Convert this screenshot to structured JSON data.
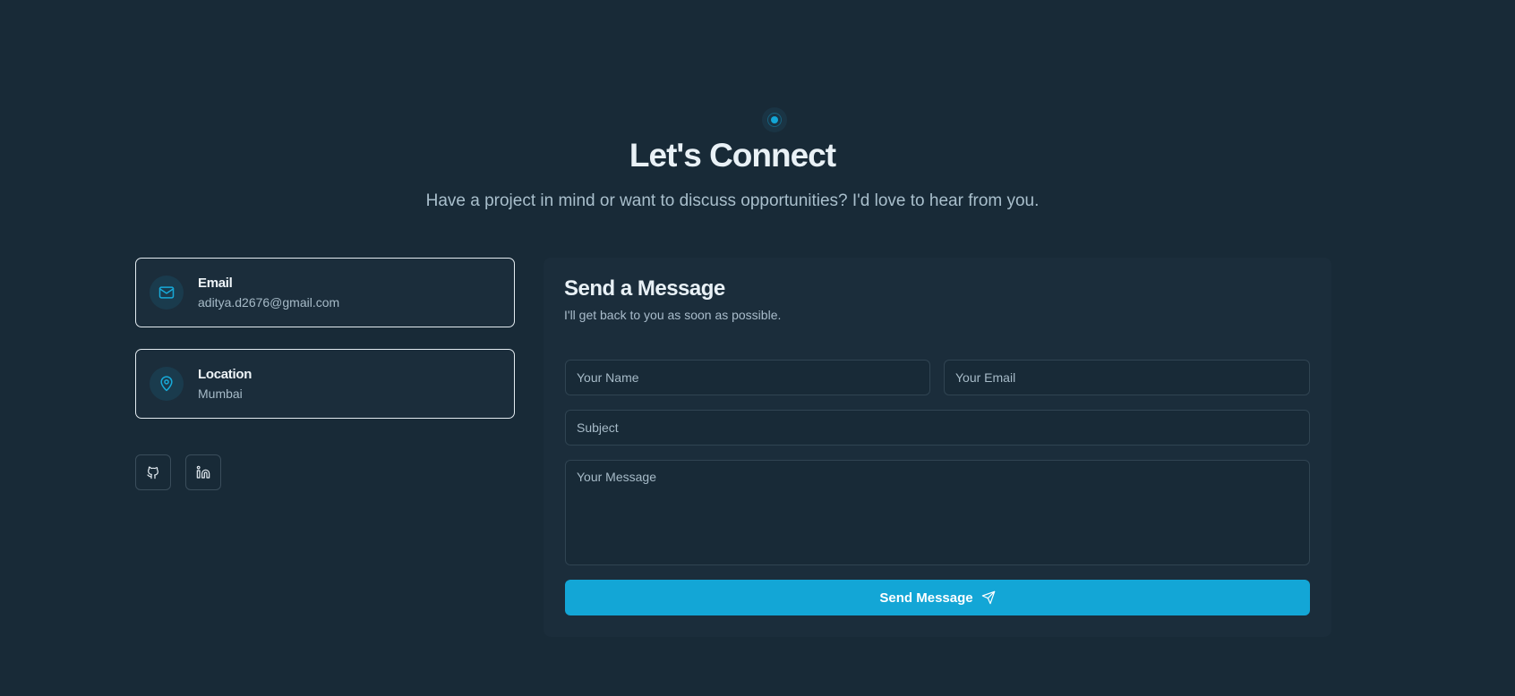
{
  "header": {
    "title": "Let's Connect",
    "subtitle": "Have a project in mind or want to discuss opportunities? I'd love to hear from you."
  },
  "contact": {
    "email": {
      "label": "Email",
      "value": "aditya.d2676@gmail.com",
      "icon": "mail-icon"
    },
    "location": {
      "label": "Location",
      "value": "Mumbai",
      "icon": "map-pin-icon"
    }
  },
  "social": [
    {
      "name": "github",
      "icon": "github-icon"
    },
    {
      "name": "linkedin",
      "icon": "linkedin-icon"
    }
  ],
  "form": {
    "title": "Send a Message",
    "subtitle": "I'll get back to you as soon as possible.",
    "name_placeholder": "Your Name",
    "email_placeholder": "Your Email",
    "subject_placeholder": "Subject",
    "message_placeholder": "Your Message",
    "submit_label": "Send Message"
  },
  "colors": {
    "background": "#182a37",
    "card": "#1b2d3b",
    "accent": "#13a6d6"
  }
}
